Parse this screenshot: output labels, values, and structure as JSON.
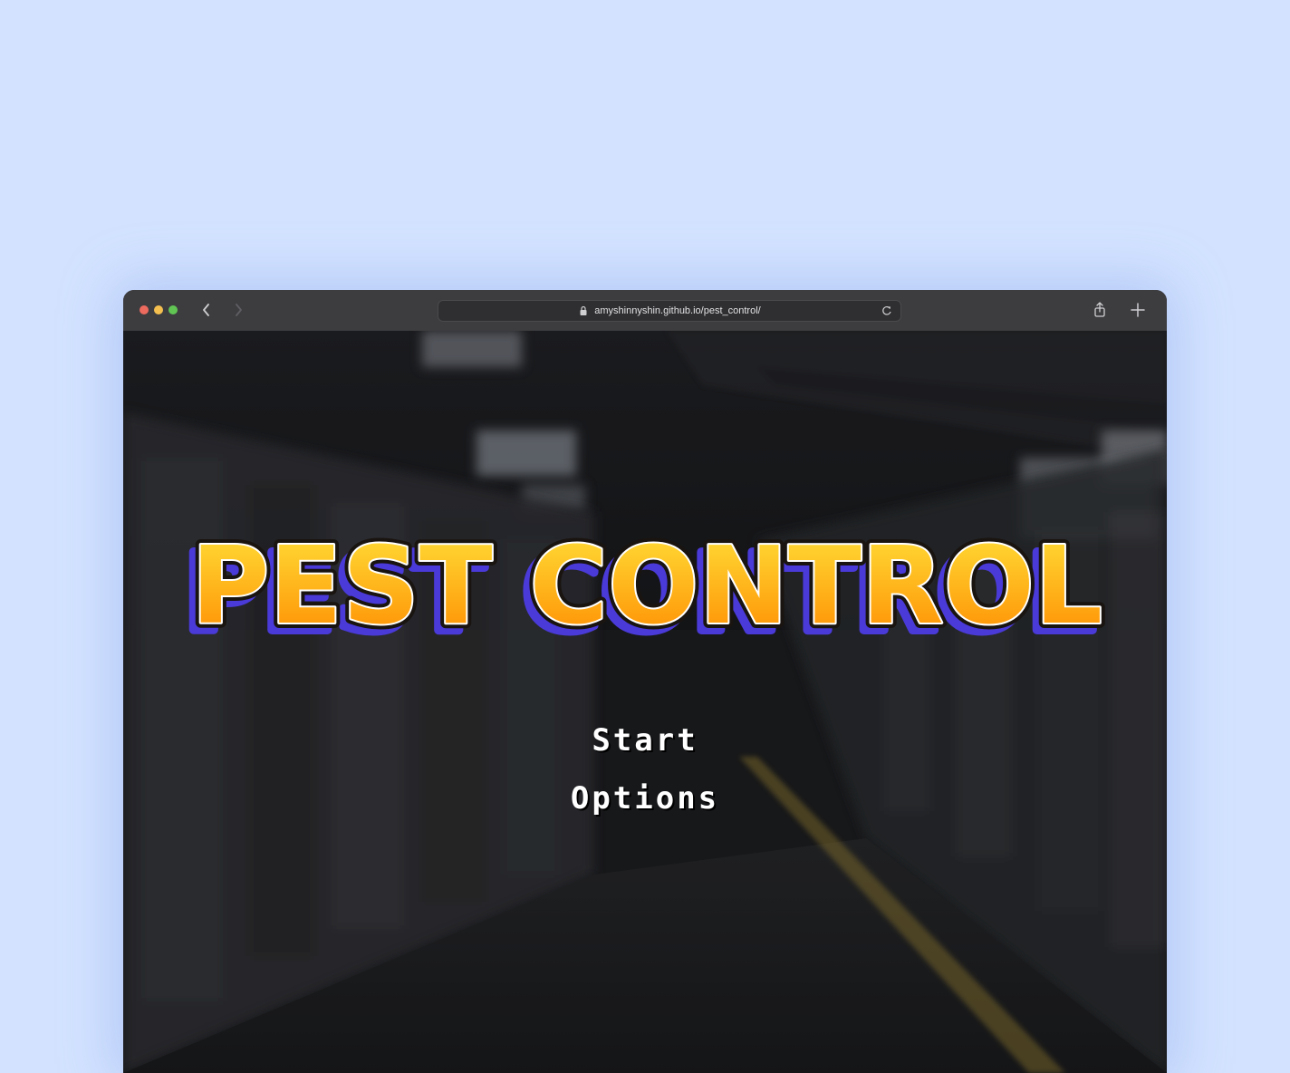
{
  "browser": {
    "url": "amyshinnyshin.github.io/pest_control/",
    "icons": {
      "back": "chevron-left-icon",
      "forward": "chevron-right-icon",
      "lock": "lock-icon",
      "reload": "reload-icon",
      "share": "share-icon",
      "new_tab": "plus-icon"
    }
  },
  "game": {
    "title": "PEST CONTROL",
    "menu": {
      "start_label": "Start",
      "options_label": "Options"
    },
    "colors": {
      "title_top": "#ffe23a",
      "title_bottom": "#ff8a00",
      "title_outline": "#ffffff",
      "title_shadow": "#4a3ad8",
      "background": "#1e1f22"
    }
  }
}
